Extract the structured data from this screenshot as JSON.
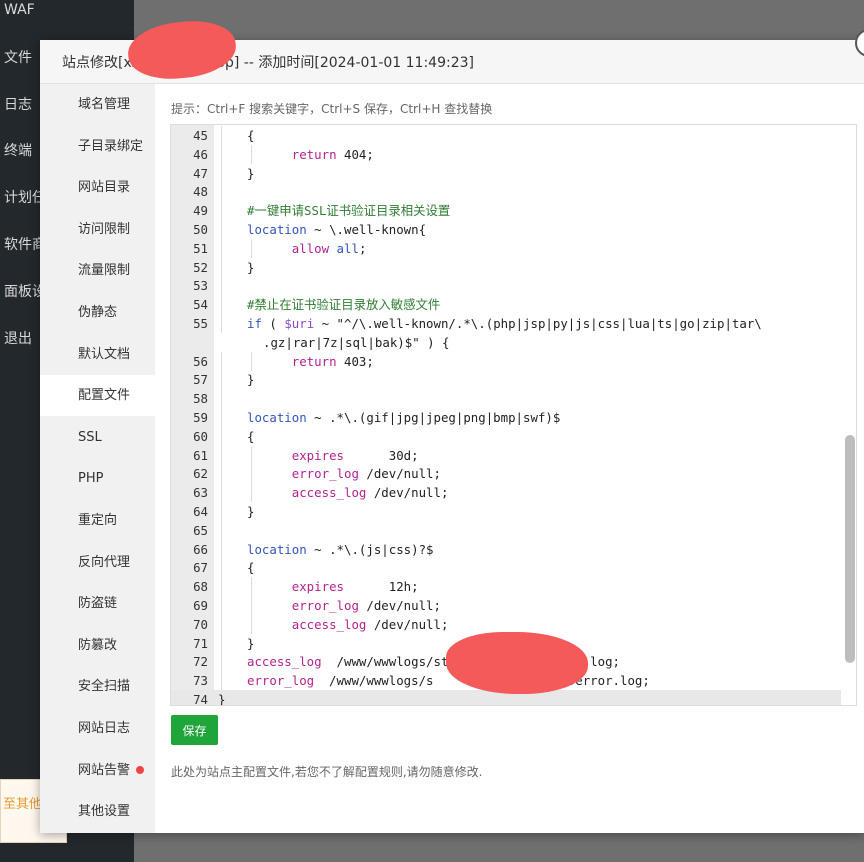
{
  "background": {
    "sidebar_items": [
      "WAF",
      "文件",
      "日志",
      "终端",
      "计划任",
      "软件商",
      "面板设",
      "退出"
    ],
    "tip_text": "至其他设"
  },
  "modal": {
    "title": "站点修改[xxxxxxxxea.top] -- 添加时间[2024-01-01 11:49:23]",
    "close_label": "×"
  },
  "menu": {
    "items": [
      "域名管理",
      "子目录绑定",
      "网站目录",
      "访问限制",
      "流量限制",
      "伪静态",
      "默认文档",
      "配置文件",
      "SSL",
      "PHP",
      "重定向",
      "反向代理",
      "防盗链",
      "防篡改",
      "安全扫描",
      "网站日志",
      "网站告警",
      "其他设置"
    ],
    "active_index": 7,
    "alert_index": 16
  },
  "hint": "提示：Ctrl+F 搜索关键字，Ctrl+S 保存，Ctrl+H 查找替换",
  "editor": {
    "lines": [
      {
        "n": "45",
        "code": "{"
      },
      {
        "n": "46",
        "code": "    return 404;"
      },
      {
        "n": "47",
        "code": "}"
      },
      {
        "n": "48",
        "code": ""
      },
      {
        "n": "49",
        "code": "#一键申请SSL证书验证目录相关设置"
      },
      {
        "n": "50",
        "code": "location ~ \\.well-known{"
      },
      {
        "n": "51",
        "code": "    allow all;"
      },
      {
        "n": "52",
        "code": "}"
      },
      {
        "n": "53",
        "code": ""
      },
      {
        "n": "54",
        "code": "#禁止在证书验证目录放入敏感文件"
      },
      {
        "n": "55",
        "code": "if ( $uri ~ \"^/\\.well-known/.*\\.(php|jsp|py|js|css|lua|ts|go|zip|tar\\"
      },
      {
        "n": "",
        "code": ".gz|rar|7z|sql|bak)$\" ) {"
      },
      {
        "n": "56",
        "code": "    return 403;"
      },
      {
        "n": "57",
        "code": "}"
      },
      {
        "n": "58",
        "code": ""
      },
      {
        "n": "59",
        "code": "location ~ .*\\.(gif|jpg|jpeg|png|bmp|swf)$"
      },
      {
        "n": "60",
        "code": "{"
      },
      {
        "n": "61",
        "code": "    expires      30d;"
      },
      {
        "n": "62",
        "code": "    error_log /dev/null;"
      },
      {
        "n": "63",
        "code": "    access_log /dev/null;"
      },
      {
        "n": "64",
        "code": "}"
      },
      {
        "n": "65",
        "code": ""
      },
      {
        "n": "66",
        "code": "location ~ .*\\.(js|css)?$"
      },
      {
        "n": "67",
        "code": "{"
      },
      {
        "n": "68",
        "code": "    expires      12h;"
      },
      {
        "n": "69",
        "code": "    error_log /dev/null;"
      },
      {
        "n": "70",
        "code": "    access_log /dev/null;"
      },
      {
        "n": "71",
        "code": "}"
      },
      {
        "n": "72",
        "code": "access_log  /www/wwwlogs/st           rea.top.log;"
      },
      {
        "n": "73",
        "code": "error_log  /www/wwwlogs/s             a.top.error.log;"
      },
      {
        "n": "74",
        "code": "}"
      }
    ],
    "current_line": "74"
  },
  "save_label": "保存",
  "footnote": "此处为站点主配置文件,若您不了解配置规则,请勿随意修改."
}
